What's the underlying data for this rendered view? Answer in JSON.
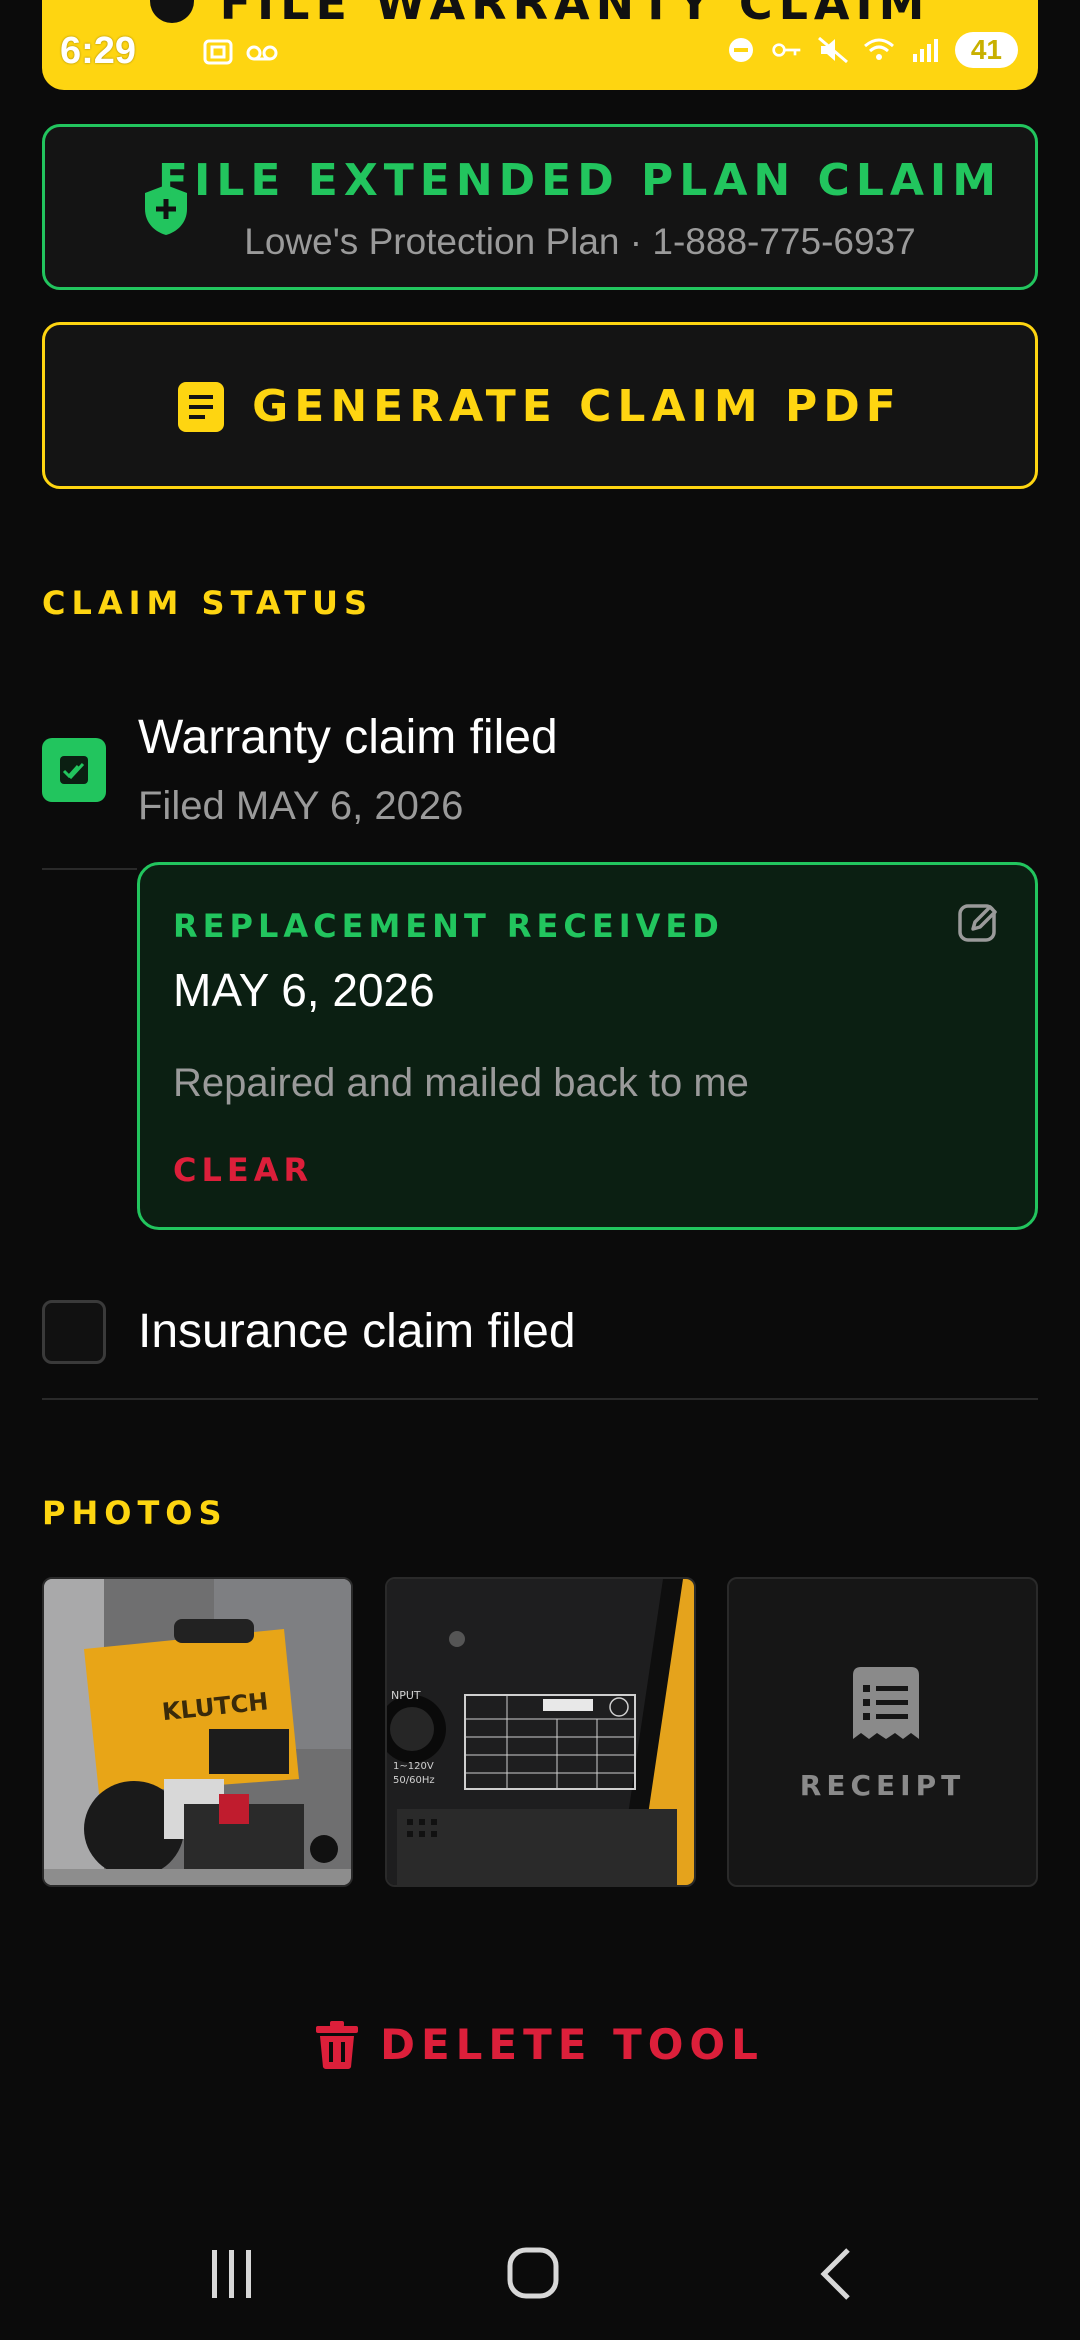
{
  "status_bar": {
    "time": "6:29",
    "battery": "41"
  },
  "top_banner": {
    "title": "FILE WARRANTY CLAIM"
  },
  "extended_plan_button": {
    "title": "FILE EXTENDED PLAN CLAIM",
    "subtitle": "Lowe's Protection Plan · 1-888-775-6937"
  },
  "pdf_button": {
    "title": "GENERATE CLAIM PDF"
  },
  "claim_status": {
    "header": "CLAIM STATUS",
    "warranty": {
      "label": "Warranty claim filed",
      "sub": "Filed MAY 6, 2026",
      "checked": true
    },
    "replacement": {
      "heading": "REPLACEMENT RECEIVED",
      "date": "MAY 6, 2026",
      "note": "Repaired and mailed back to me",
      "clear_label": "CLEAR"
    },
    "insurance": {
      "label": "Insurance claim filed",
      "checked": false
    }
  },
  "photos": {
    "header": "PHOTOS",
    "receipt_label": "RECEIPT"
  },
  "delete": {
    "label": "DELETE TOOL"
  },
  "colors": {
    "accent_yellow": "#fed511",
    "accent_green": "#22c55e",
    "danger_red": "#dc1f3a",
    "background": "#0b0b0b"
  }
}
